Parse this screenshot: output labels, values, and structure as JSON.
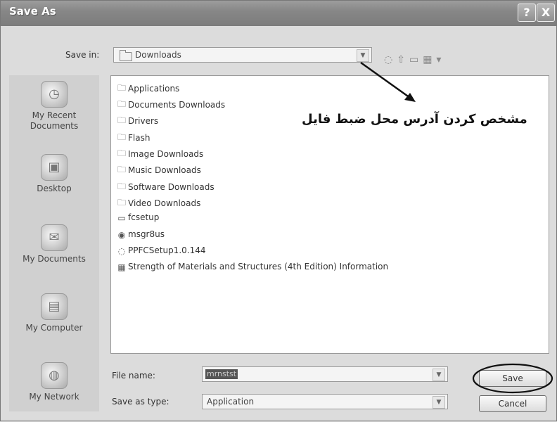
{
  "window": {
    "title": "Save As",
    "help_button": "?",
    "close_button": "X"
  },
  "save_in": {
    "label": "Save in:",
    "value": "Downloads"
  },
  "toolbar": {
    "icons": [
      "back-icon",
      "up-folder-icon",
      "new-folder-icon",
      "views-menu-icon"
    ]
  },
  "places": [
    {
      "label": "My Recent Documents",
      "line1": "My Recent",
      "line2": "Documents",
      "icon": "recent-documents-icon"
    },
    {
      "label": "Desktop",
      "line1": "Desktop",
      "line2": "",
      "icon": "desktop-icon"
    },
    {
      "label": "My Documents",
      "line1": "My Documents",
      "line2": "",
      "icon": "my-documents-icon"
    },
    {
      "label": "My Computer",
      "line1": "My Computer",
      "line2": "",
      "icon": "my-computer-icon"
    },
    {
      "label": "My Network",
      "line1": "My Network",
      "line2": "",
      "icon": "my-network-icon"
    }
  ],
  "files": [
    {
      "name": "Applications",
      "type": "folder"
    },
    {
      "name": "Documents Downloads",
      "type": "folder"
    },
    {
      "name": "Drivers",
      "type": "folder"
    },
    {
      "name": "Flash",
      "type": "folder"
    },
    {
      "name": "Image Downloads",
      "type": "folder"
    },
    {
      "name": "Music Downloads",
      "type": "folder"
    },
    {
      "name": "Software Downloads",
      "type": "folder"
    },
    {
      "name": "Video Downloads",
      "type": "folder"
    },
    {
      "name": "fcsetup",
      "type": "file"
    },
    {
      "name": "msgr8us",
      "type": "app"
    },
    {
      "name": "PPFCSetup1.0.144",
      "type": "setup"
    },
    {
      "name": "Strength of Materials and Structures (4th Edition) Information",
      "type": "info"
    }
  ],
  "annotation": "مشخص کردن آدرس محل ضبط فایل",
  "file_name": {
    "label": "File name:",
    "value": "mrnstst"
  },
  "save_as_type": {
    "label": "Save as type:",
    "value": "Application"
  },
  "buttons": {
    "save": "Save",
    "cancel": "Cancel"
  }
}
